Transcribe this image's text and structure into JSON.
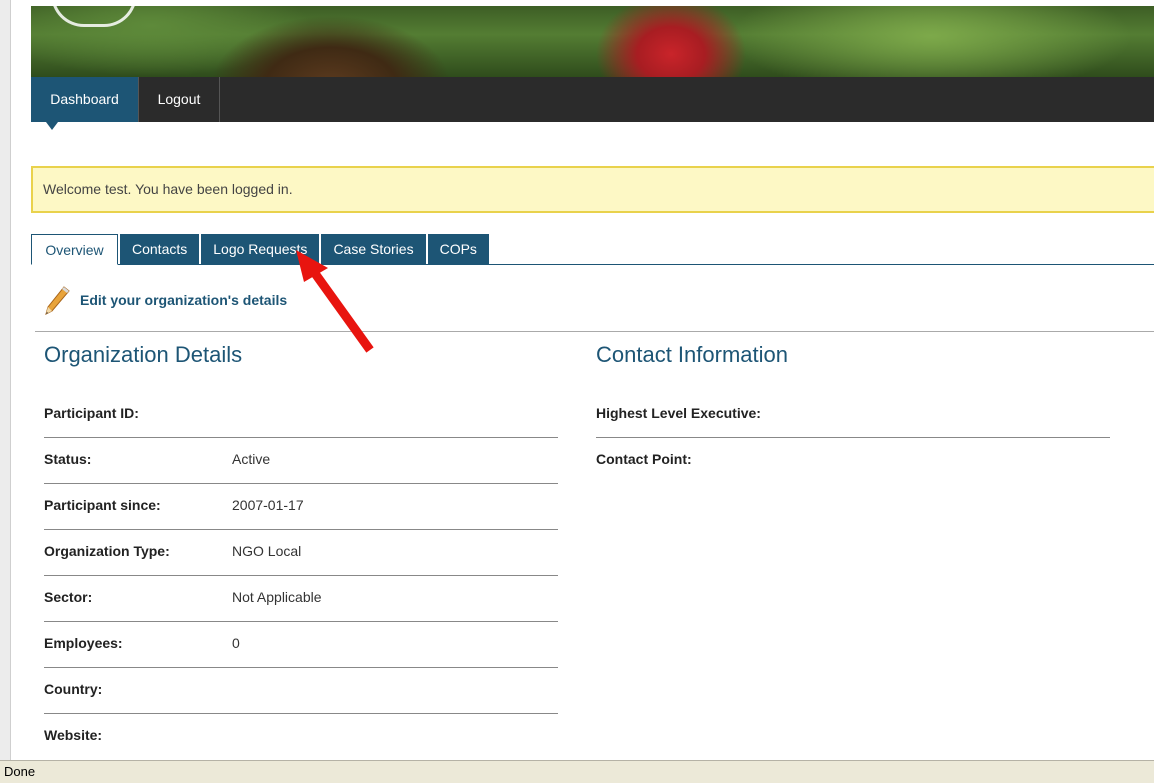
{
  "nav": {
    "items": [
      {
        "label": "Dashboard"
      },
      {
        "label": "Logout"
      }
    ]
  },
  "flash": {
    "message": "Welcome test. You have been logged in."
  },
  "tabs": [
    {
      "label": "Overview"
    },
    {
      "label": "Contacts"
    },
    {
      "label": "Logo Requests"
    },
    {
      "label": "Case Stories"
    },
    {
      "label": "COPs"
    }
  ],
  "edit": {
    "label": "Edit your organization's details",
    "icon": "pencil-icon"
  },
  "organization": {
    "heading": "Organization Details",
    "rows": [
      {
        "label": "Participant ID:",
        "value": ""
      },
      {
        "label": "Status:",
        "value": "Active"
      },
      {
        "label": "Participant since:",
        "value": "2007-01-17"
      },
      {
        "label": "Organization Type:",
        "value": "NGO Local"
      },
      {
        "label": "Sector:",
        "value": "Not Applicable"
      },
      {
        "label": "Employees:",
        "value": "0"
      },
      {
        "label": "Country:",
        "value": ""
      },
      {
        "label": "Website:",
        "value": ""
      }
    ]
  },
  "contact": {
    "heading": "Contact Information",
    "rows": [
      {
        "label": "Highest Level Executive:"
      },
      {
        "label": "Contact Point:"
      }
    ]
  },
  "status_bar": {
    "text": "Done"
  },
  "colors": {
    "accent": "#1d5575",
    "nav_bg": "#2b2b2b",
    "flash_bg": "#fdf8c5",
    "annotation": "#e8140f"
  }
}
